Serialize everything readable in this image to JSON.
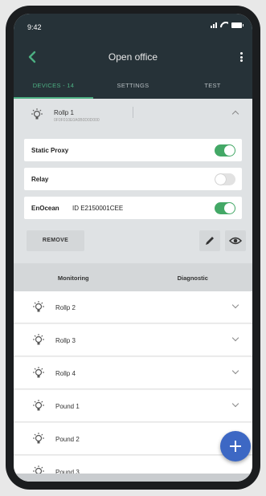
{
  "status_bar": {
    "time": "9:42"
  },
  "app_bar": {
    "title": "Open office"
  },
  "tabs": [
    {
      "label": "DEVICES - 14",
      "active": true
    },
    {
      "label": "SETTINGS",
      "active": false
    },
    {
      "label": "TEST",
      "active": false
    }
  ],
  "expanded_device": {
    "name": "Rollp 1",
    "subtitle": "0F0F010E0A0B0D0D000",
    "settings": [
      {
        "label": "Static Proxy",
        "value": "",
        "on": true
      },
      {
        "label": "Relay",
        "value": "",
        "on": false
      },
      {
        "label": "EnOcean",
        "value": "ID E2150001CEE",
        "on": true
      }
    ],
    "remove_label": "REMOVE",
    "subtabs": [
      "Monitoring",
      "Diagnostic"
    ]
  },
  "devices": [
    {
      "name": "Rollp 2"
    },
    {
      "name": "Rollp 3"
    },
    {
      "name": "Rollp 4"
    },
    {
      "name": "Pound 1"
    },
    {
      "name": "Pound 2"
    },
    {
      "name": "Pound 3"
    }
  ],
  "colors": {
    "accent": "#4caf82",
    "toggle_on": "#43a866",
    "fab": "#3d68c4",
    "header": "#263238"
  }
}
